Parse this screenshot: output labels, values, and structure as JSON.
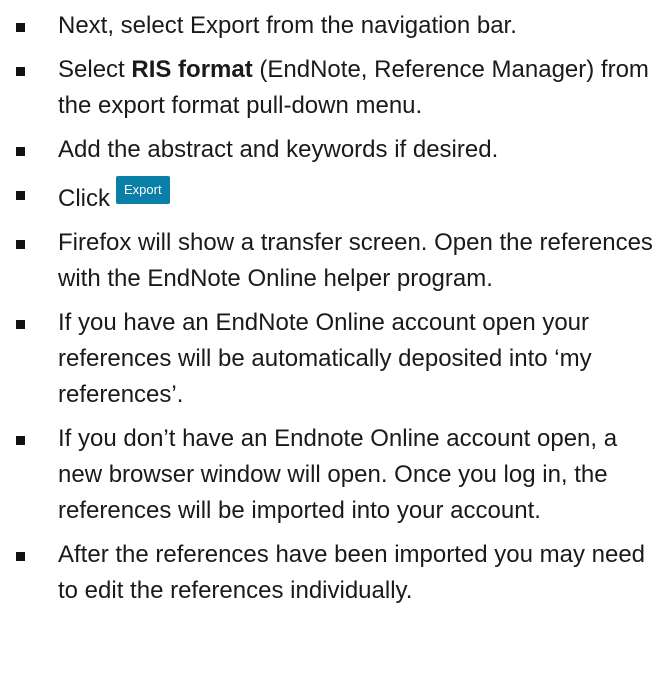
{
  "steps": [
    {
      "text": "Next, select Export from the navigation bar."
    },
    {
      "prefix": "Select ",
      "bold": "RIS format",
      "suffix": " (EndNote, Reference Manager) from the export format pull-down menu."
    },
    {
      "text": "Add the abstract and keywords if desired."
    },
    {
      "text": "Click",
      "button_label": "Export"
    },
    {
      "text": "Firefox will show a transfer screen. Open the references with the EndNote Online helper program."
    },
    {
      "text": "If you have an EndNote Online account open your references will be automatically deposited into ‘my references’."
    },
    {
      "text": "If you don’t have an Endnote Online account open, a new browser window will open.  Once you log in, the references will be imported into your account."
    },
    {
      "text": "After the references have been imported you may need to edit the references individually."
    }
  ],
  "colors": {
    "export_button_bg": "#0a7fa8",
    "export_button_text": "#ffffff",
    "text": "#1a1a1a"
  }
}
